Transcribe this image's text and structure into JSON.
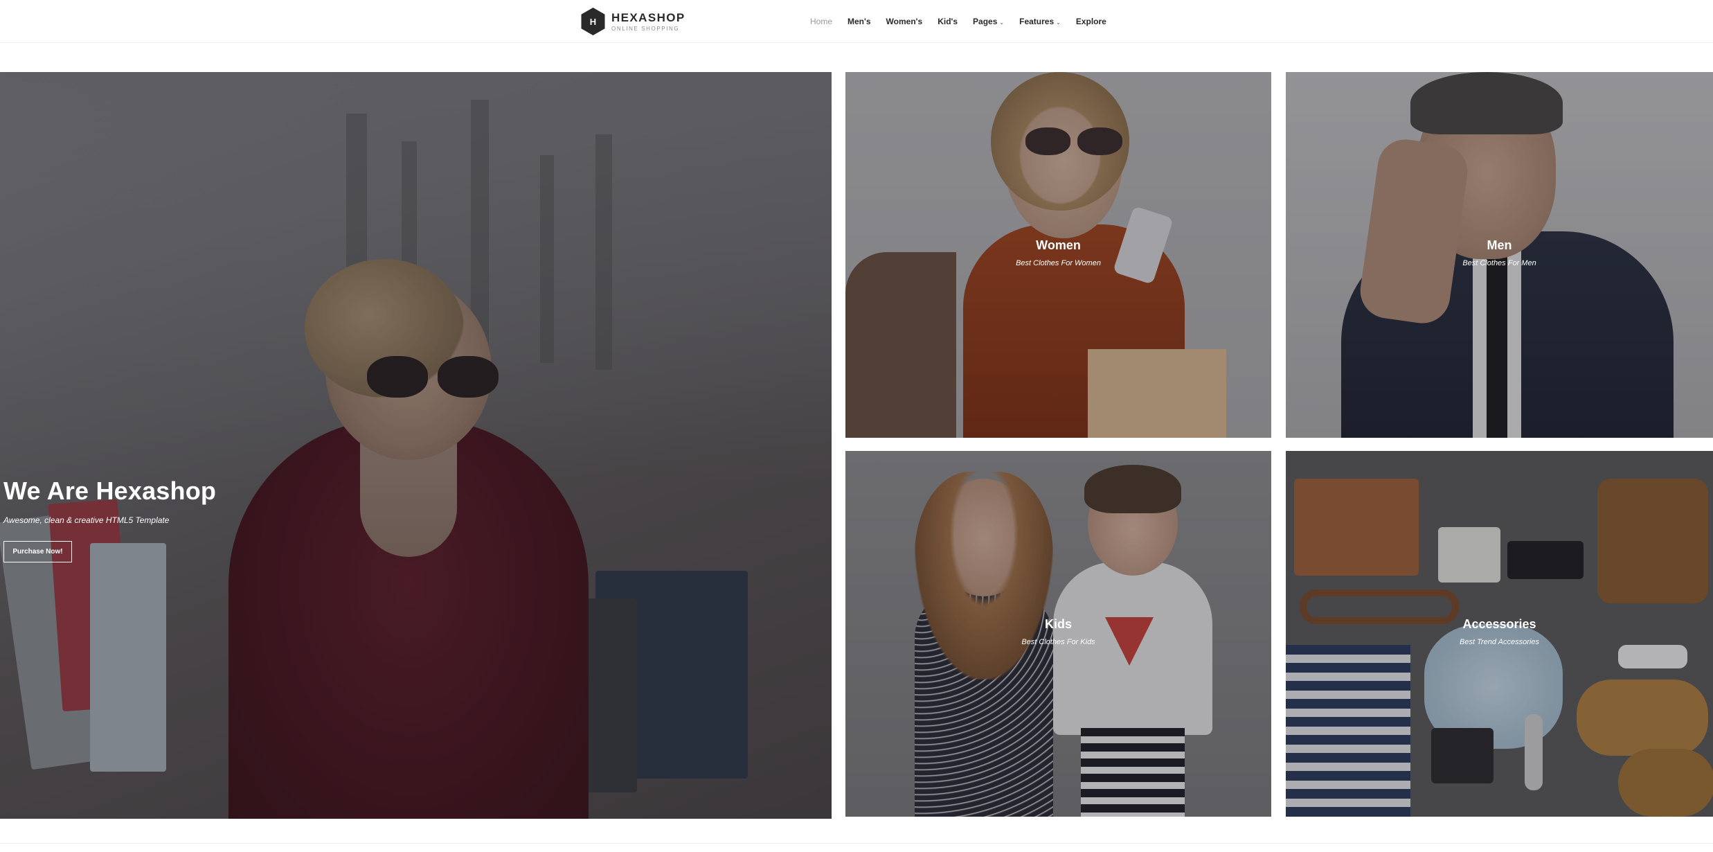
{
  "brand": {
    "logo_letter": "H",
    "title": "HEXASHOP",
    "subtitle": "ONLINE SHOPPING"
  },
  "nav": {
    "items": [
      {
        "label": "Home",
        "active": true
      },
      {
        "label": "Men's"
      },
      {
        "label": "Women's"
      },
      {
        "label": "Kid's"
      },
      {
        "label": "Pages",
        "dropdown": true
      },
      {
        "label": "Features",
        "dropdown": true
      },
      {
        "label": "Explore"
      }
    ]
  },
  "hero": {
    "title": "We Are Hexashop",
    "subtitle": "Awesome, clean & creative HTML5 Template",
    "button": "Purchase Now!"
  },
  "categories": [
    {
      "title": "Women",
      "subtitle": "Best Clothes For Women"
    },
    {
      "title": "Men",
      "subtitle": "Best Clothes For Men"
    },
    {
      "title": "Kids",
      "subtitle": "Best Clothes For Kids"
    },
    {
      "title": "Accessories",
      "subtitle": "Best Trend Accessories"
    }
  ],
  "colors": {
    "text_dark": "#2a2a2a",
    "nav_active": "#9a9a9a",
    "overlay_text": "#ffffff"
  }
}
